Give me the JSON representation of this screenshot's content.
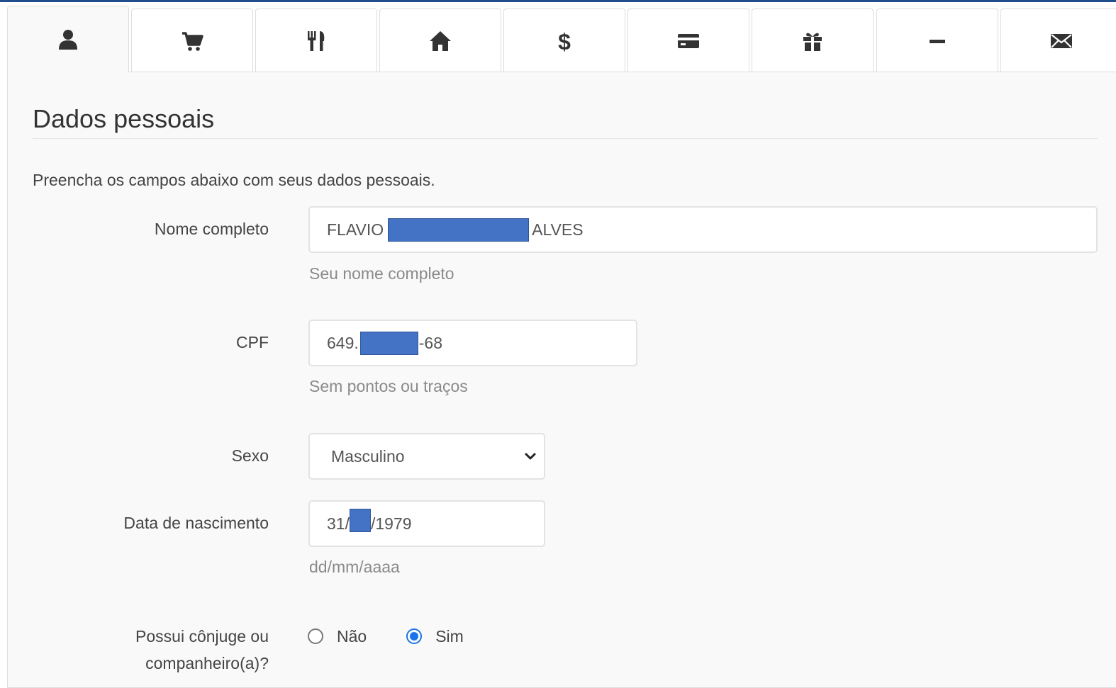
{
  "tabs": [
    {
      "icon": "user-icon",
      "active": true
    },
    {
      "icon": "cart-icon",
      "active": false
    },
    {
      "icon": "cutlery-icon",
      "active": false
    },
    {
      "icon": "home-icon",
      "active": false
    },
    {
      "icon": "dollar-icon",
      "active": false
    },
    {
      "icon": "credit-card-icon",
      "active": false
    },
    {
      "icon": "gift-icon",
      "active": false
    },
    {
      "icon": "minus-icon",
      "active": false
    },
    {
      "icon": "envelope-icon",
      "active": false
    }
  ],
  "section": {
    "title": "Dados pessoais",
    "intro": "Preencha os campos abaixo com seus dados pessoais."
  },
  "form": {
    "name": {
      "label": "Nome completo",
      "value_start": "FLAVIO",
      "value_end": "ALVES",
      "help": "Seu nome completo"
    },
    "cpf": {
      "label": "CPF",
      "value_start": "649.",
      "value_end": "-68",
      "help": "Sem pontos ou traços"
    },
    "sex": {
      "label": "Sexo",
      "selected": "Masculino"
    },
    "birth": {
      "label": "Data de nascimento",
      "value_start": "31/",
      "value_end": "/1979",
      "help": "dd/mm/aaaa"
    },
    "spouse": {
      "label_line1": "Possui cônjuge ou",
      "label_line2": "companheiro(a)?",
      "options": [
        {
          "label": "Não",
          "checked": false
        },
        {
          "label": "Sim",
          "checked": true
        }
      ]
    }
  },
  "colors": {
    "redaction": "#4472c4",
    "radio_accent": "#1a73e8",
    "top_border": "#1f4e8c"
  }
}
